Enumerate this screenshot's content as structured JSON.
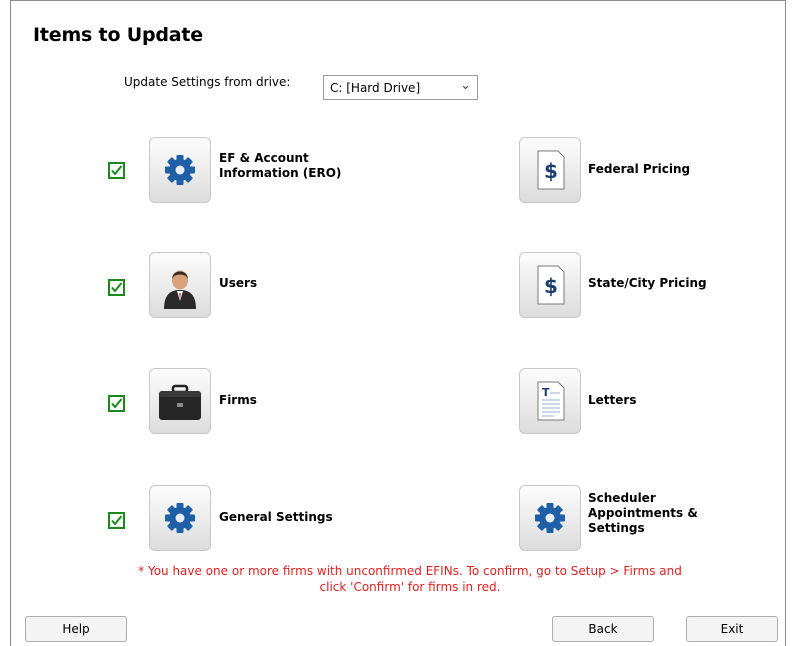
{
  "title": "Items to Update",
  "drive": {
    "label": "Update Settings from drive:",
    "value": "C: [Hard Drive]"
  },
  "left_items": [
    {
      "label": "EF & Account Information (ERO)",
      "icon": "gear-icon",
      "checked": true
    },
    {
      "label": "Users",
      "icon": "user-icon",
      "checked": true
    },
    {
      "label": "Firms",
      "icon": "briefcase-icon",
      "checked": true
    },
    {
      "label": "General Settings",
      "icon": "gear-icon",
      "checked": true
    }
  ],
  "right_items": [
    {
      "label": "Federal Pricing",
      "icon": "dollar-document-icon"
    },
    {
      "label": "State/City Pricing",
      "icon": "dollar-document-icon"
    },
    {
      "label": "Letters",
      "icon": "letter-document-icon"
    },
    {
      "label": "Scheduler Appointments & Settings",
      "icon": "gear-icon"
    }
  ],
  "warning": "* You have one or more firms with unconfirmed EFINs. To confirm, go to Setup > Firms and click 'Confirm' for firms in red.",
  "buttons": {
    "help": "Help",
    "back": "Back",
    "exit": "Exit"
  },
  "colors": {
    "check_green": "#1a8a1a",
    "warning_red": "#e02020",
    "gear_blue": "#1f5fa8"
  }
}
